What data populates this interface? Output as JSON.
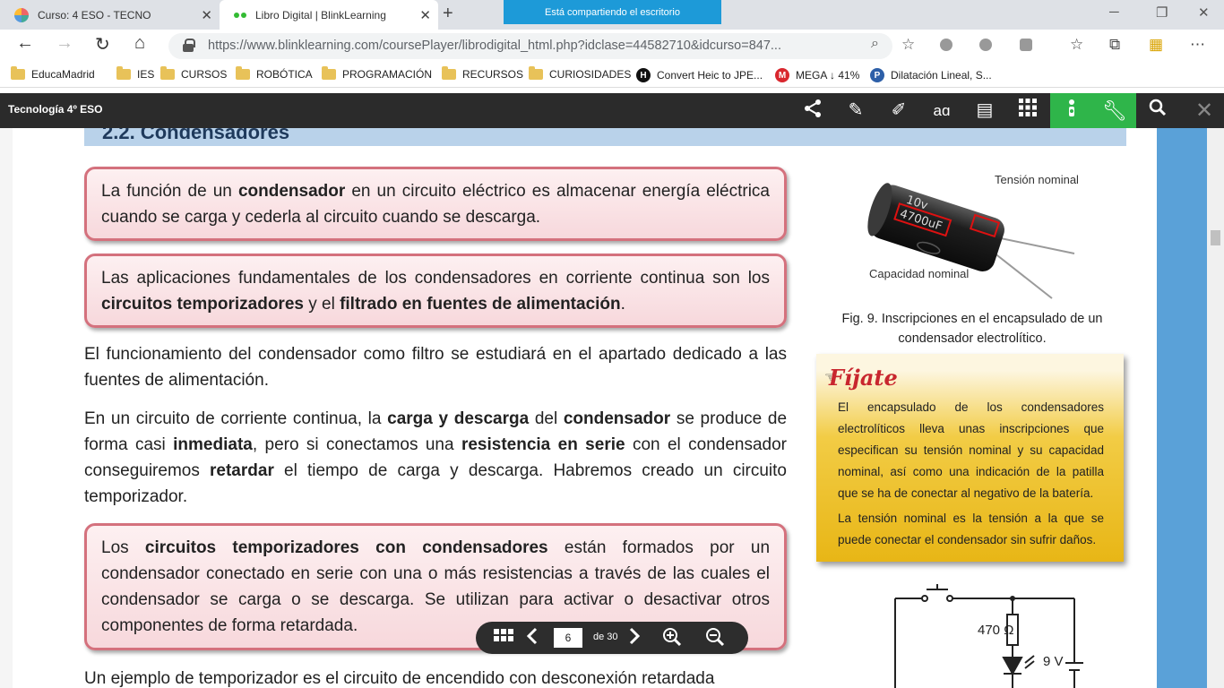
{
  "browser": {
    "tabs": [
      {
        "title": "Curso: 4 ESO - TECNO",
        "active": false
      },
      {
        "title": "Libro Digital | BlinkLearning",
        "active": true
      }
    ],
    "sharing_banner": "Está compartiendo el escritorio",
    "url": "https://www.blinklearning.com/coursePlayer/librodigital_html.php?idclase=44582710&idcurso=847..."
  },
  "bookmarks": [
    {
      "label": "EducaMadrid",
      "icon": "folder"
    },
    {
      "label": "IES",
      "icon": "folder"
    },
    {
      "label": "CURSOS",
      "icon": "folder"
    },
    {
      "label": "ROBÓTICA",
      "icon": "folder"
    },
    {
      "label": "PROGRAMACIÓN",
      "icon": "folder"
    },
    {
      "label": "RECURSOS",
      "icon": "folder"
    },
    {
      "label": "CURIOSIDADES",
      "icon": "folder"
    },
    {
      "label": "Convert Heic to JPE...",
      "icon": "heic-icon"
    },
    {
      "label": "MEGA ↓ 41%",
      "icon": "mega-icon"
    },
    {
      "label": "Dilatación Lineal, S...",
      "icon": "site-icon"
    }
  ],
  "app": {
    "title": "Tecnología 4º ESO",
    "accent": "#2fb54a"
  },
  "content": {
    "section_title": "2.2. Condensadores",
    "box1": {
      "t1": "La función de un ",
      "b1": "condensador",
      "t2": " en un circuito eléctrico es almacenar energía eléctrica cuando se carga y cederla al circuito cuando se descarga."
    },
    "box2": {
      "t1": "Las aplicaciones fundamentales de los condensadores en corriente continua son los ",
      "b1": "circuitos temporizadores",
      "t2": " y el ",
      "b2": "filtrado en fuentes de alimentación",
      "t3": "."
    },
    "para1": "El funcionamiento del condensador como filtro se estudiará en el apartado dedicado a las fuentes de alimentación.",
    "para2": {
      "t1": "En un circuito de corriente continua, la ",
      "b1": "carga y descarga",
      "t2": " del ",
      "b2": "condensador",
      "t3": " se produce de forma casi ",
      "b3": "inmediata",
      "t4": ", pero si conectamos una ",
      "b4": "resistencia en serie",
      "t5": " con el condensador conseguiremos ",
      "b5": "retardar",
      "t6": " el tiempo de carga y descarga. Habremos creado un circuito temporizador."
    },
    "box3": {
      "t1": "Los ",
      "b1": "circuitos temporizadores con condensadores",
      "t2": " están formados por un condensador conectado en serie con una o más resistencias a través de las cuales el condensador se carga o se descarga. Se utilizan para activar o desactivar otros componentes de forma retardada."
    },
    "para3": "Un ejemplo de temporizador es el circuito de encendido con desconexión retardada",
    "figure": {
      "label_tension": "Tensión nominal",
      "label_capacidad": "Capacidad nominal",
      "cap_text_voltage": "10v",
      "cap_text_capacity": "4700uF",
      "caption": "Fig. 9. Inscripciones en el encapsulado de un condensador electrolítico."
    },
    "fijate": {
      "title": "Fíjate",
      "p1": "El encapsulado de los condensadores electrolíticos lleva unas inscripciones que especifican su tensión nominal y su capacidad nominal, así como una indicación de la patilla que se ha de conectar al negativo de la batería.",
      "p2": "La tensión nominal es la tensión a la que se puede conectar el condensador sin sufrir daños."
    },
    "circuit": {
      "resistor_label": "470 Ω",
      "battery_label": "9 V"
    }
  },
  "pagenav": {
    "current_page": "6",
    "of_label": "de 30"
  }
}
